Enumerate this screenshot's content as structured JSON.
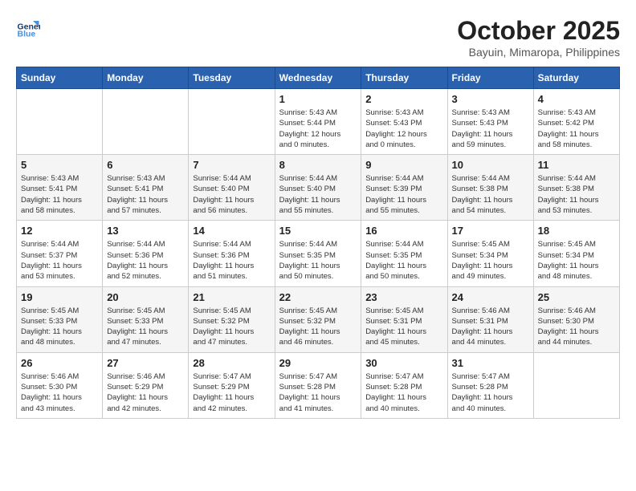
{
  "header": {
    "logo": {
      "line1": "General",
      "line2": "Blue"
    },
    "month": "October 2025",
    "location": "Bayuin, Mimaropa, Philippines"
  },
  "weekdays": [
    "Sunday",
    "Monday",
    "Tuesday",
    "Wednesday",
    "Thursday",
    "Friday",
    "Saturday"
  ],
  "weeks": [
    [
      {
        "day": "",
        "info": ""
      },
      {
        "day": "",
        "info": ""
      },
      {
        "day": "",
        "info": ""
      },
      {
        "day": "1",
        "info": "Sunrise: 5:43 AM\nSunset: 5:44 PM\nDaylight: 12 hours\nand 0 minutes."
      },
      {
        "day": "2",
        "info": "Sunrise: 5:43 AM\nSunset: 5:43 PM\nDaylight: 12 hours\nand 0 minutes."
      },
      {
        "day": "3",
        "info": "Sunrise: 5:43 AM\nSunset: 5:43 PM\nDaylight: 11 hours\nand 59 minutes."
      },
      {
        "day": "4",
        "info": "Sunrise: 5:43 AM\nSunset: 5:42 PM\nDaylight: 11 hours\nand 58 minutes."
      }
    ],
    [
      {
        "day": "5",
        "info": "Sunrise: 5:43 AM\nSunset: 5:41 PM\nDaylight: 11 hours\nand 58 minutes."
      },
      {
        "day": "6",
        "info": "Sunrise: 5:43 AM\nSunset: 5:41 PM\nDaylight: 11 hours\nand 57 minutes."
      },
      {
        "day": "7",
        "info": "Sunrise: 5:44 AM\nSunset: 5:40 PM\nDaylight: 11 hours\nand 56 minutes."
      },
      {
        "day": "8",
        "info": "Sunrise: 5:44 AM\nSunset: 5:40 PM\nDaylight: 11 hours\nand 55 minutes."
      },
      {
        "day": "9",
        "info": "Sunrise: 5:44 AM\nSunset: 5:39 PM\nDaylight: 11 hours\nand 55 minutes."
      },
      {
        "day": "10",
        "info": "Sunrise: 5:44 AM\nSunset: 5:38 PM\nDaylight: 11 hours\nand 54 minutes."
      },
      {
        "day": "11",
        "info": "Sunrise: 5:44 AM\nSunset: 5:38 PM\nDaylight: 11 hours\nand 53 minutes."
      }
    ],
    [
      {
        "day": "12",
        "info": "Sunrise: 5:44 AM\nSunset: 5:37 PM\nDaylight: 11 hours\nand 53 minutes."
      },
      {
        "day": "13",
        "info": "Sunrise: 5:44 AM\nSunset: 5:36 PM\nDaylight: 11 hours\nand 52 minutes."
      },
      {
        "day": "14",
        "info": "Sunrise: 5:44 AM\nSunset: 5:36 PM\nDaylight: 11 hours\nand 51 minutes."
      },
      {
        "day": "15",
        "info": "Sunrise: 5:44 AM\nSunset: 5:35 PM\nDaylight: 11 hours\nand 50 minutes."
      },
      {
        "day": "16",
        "info": "Sunrise: 5:44 AM\nSunset: 5:35 PM\nDaylight: 11 hours\nand 50 minutes."
      },
      {
        "day": "17",
        "info": "Sunrise: 5:45 AM\nSunset: 5:34 PM\nDaylight: 11 hours\nand 49 minutes."
      },
      {
        "day": "18",
        "info": "Sunrise: 5:45 AM\nSunset: 5:34 PM\nDaylight: 11 hours\nand 48 minutes."
      }
    ],
    [
      {
        "day": "19",
        "info": "Sunrise: 5:45 AM\nSunset: 5:33 PM\nDaylight: 11 hours\nand 48 minutes."
      },
      {
        "day": "20",
        "info": "Sunrise: 5:45 AM\nSunset: 5:33 PM\nDaylight: 11 hours\nand 47 minutes."
      },
      {
        "day": "21",
        "info": "Sunrise: 5:45 AM\nSunset: 5:32 PM\nDaylight: 11 hours\nand 47 minutes."
      },
      {
        "day": "22",
        "info": "Sunrise: 5:45 AM\nSunset: 5:32 PM\nDaylight: 11 hours\nand 46 minutes."
      },
      {
        "day": "23",
        "info": "Sunrise: 5:45 AM\nSunset: 5:31 PM\nDaylight: 11 hours\nand 45 minutes."
      },
      {
        "day": "24",
        "info": "Sunrise: 5:46 AM\nSunset: 5:31 PM\nDaylight: 11 hours\nand 44 minutes."
      },
      {
        "day": "25",
        "info": "Sunrise: 5:46 AM\nSunset: 5:30 PM\nDaylight: 11 hours\nand 44 minutes."
      }
    ],
    [
      {
        "day": "26",
        "info": "Sunrise: 5:46 AM\nSunset: 5:30 PM\nDaylight: 11 hours\nand 43 minutes."
      },
      {
        "day": "27",
        "info": "Sunrise: 5:46 AM\nSunset: 5:29 PM\nDaylight: 11 hours\nand 42 minutes."
      },
      {
        "day": "28",
        "info": "Sunrise: 5:47 AM\nSunset: 5:29 PM\nDaylight: 11 hours\nand 42 minutes."
      },
      {
        "day": "29",
        "info": "Sunrise: 5:47 AM\nSunset: 5:28 PM\nDaylight: 11 hours\nand 41 minutes."
      },
      {
        "day": "30",
        "info": "Sunrise: 5:47 AM\nSunset: 5:28 PM\nDaylight: 11 hours\nand 40 minutes."
      },
      {
        "day": "31",
        "info": "Sunrise: 5:47 AM\nSunset: 5:28 PM\nDaylight: 11 hours\nand 40 minutes."
      },
      {
        "day": "",
        "info": ""
      }
    ]
  ]
}
